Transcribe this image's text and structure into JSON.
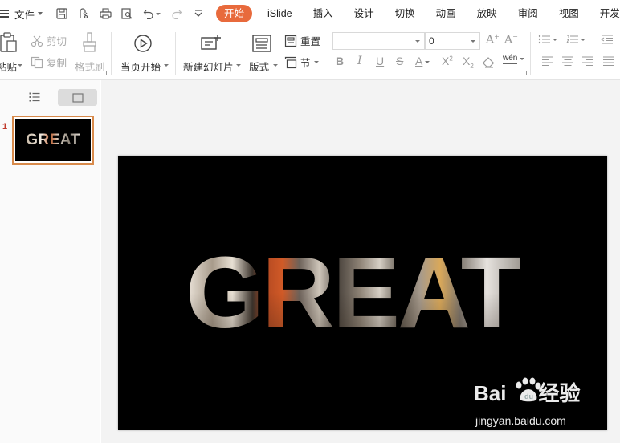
{
  "menubar": {
    "file_label": "文件",
    "tabs": [
      {
        "label": "开始",
        "active": true
      },
      {
        "label": "iSlide"
      },
      {
        "label": "插入"
      },
      {
        "label": "设计"
      },
      {
        "label": "切换"
      },
      {
        "label": "动画"
      },
      {
        "label": "放映"
      },
      {
        "label": "审阅"
      },
      {
        "label": "视图"
      },
      {
        "label": "开发工"
      }
    ],
    "quick_access_icons": [
      "save-icon",
      "share-icon",
      "print-icon",
      "print-preview-icon",
      "undo-icon",
      "redo-icon",
      "customize-icon"
    ],
    "accent_color": "#e86a3c"
  },
  "ribbon": {
    "paste_label": "粘贴",
    "cut_label": "剪切",
    "copy_label": "复制",
    "format_painter_label": "格式刷",
    "from_current_label": "当页开始",
    "new_slide_label": "新建幻灯片",
    "layout_label": "版式",
    "reset_label": "重置",
    "section_label": "节",
    "font_name_value": "",
    "font_size_value": "0",
    "wen_label": "wén"
  },
  "left_panel": {
    "slide_number": "1",
    "thumb_text": "GREAT",
    "thumb_border_color": "#d88a4b"
  },
  "slide": {
    "headline": "GREAT",
    "background": "#000000"
  },
  "watermark": {
    "logo_left": "Bai",
    "logo_right": "经验",
    "url": "jingyan.baidu.com"
  }
}
